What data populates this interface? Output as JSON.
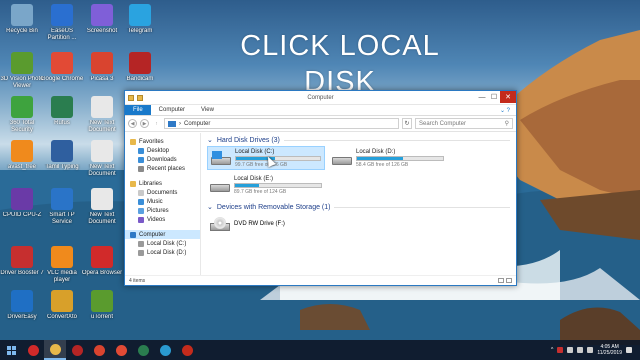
{
  "overlay": {
    "line1": "CLICK LOCAL",
    "line2": "DISK"
  },
  "desktop_icons": [
    {
      "label": "Recycle Bin",
      "icon": "recycle-bin-icon",
      "color": "#7aa6c9"
    },
    {
      "label": "EaseUS Partition ...",
      "icon": "easeus-icon",
      "color": "#2a6fd0"
    },
    {
      "label": "Screenshot",
      "icon": "screenshot-icon",
      "color": "#7f5fd8"
    },
    {
      "label": "Telegram",
      "icon": "telegram-icon",
      "color": "#2aa3e0"
    },
    {
      "label": "3D Vision Photo Viewer",
      "icon": "3d-vision-icon",
      "color": "#5a9b2e"
    },
    {
      "label": "Google Chrome",
      "icon": "chrome-icon",
      "color": "#e24a35"
    },
    {
      "label": "Picasa 3",
      "icon": "picasa-icon",
      "color": "#d9442f"
    },
    {
      "label": "Bandicam",
      "icon": "bandicam-icon",
      "color": "#b52525"
    },
    {
      "label": "360 Total Security",
      "icon": "360-icon",
      "color": "#3ea33e"
    },
    {
      "label": "Rufus",
      "icon": "rufus-icon",
      "color": "#2a7d4f"
    },
    {
      "label": "New Text Document",
      "icon": "text-doc-icon",
      "color": "#e8e8e8"
    },
    {
      "label": "avast_free",
      "icon": "avast-icon",
      "color": "#f08a1c"
    },
    {
      "label": "Tamil Typing",
      "icon": "typing-icon",
      "color": "#2f5f9f"
    },
    {
      "label": "New Text Document",
      "icon": "text-doc-icon",
      "color": "#e8e8e8"
    },
    {
      "label": "CPUID CPU-Z",
      "icon": "cpuz-icon",
      "color": "#6a3aa7"
    },
    {
      "label": "Smart TP Service",
      "icon": "smart-tp-icon",
      "color": "#2a74c8"
    },
    {
      "label": "New Text Document",
      "icon": "text-doc-icon",
      "color": "#e8e8e8"
    },
    {
      "label": "Driver Booster 7",
      "icon": "driver-booster-icon",
      "color": "#c62f2f"
    },
    {
      "label": "VLC media player",
      "icon": "vlc-icon",
      "color": "#f08a1c"
    },
    {
      "label": "Opera Browser",
      "icon": "opera-icon",
      "color": "#d12a2a"
    },
    {
      "label": "DriverEasy",
      "icon": "drivereasy-icon",
      "color": "#1f6fc4"
    },
    {
      "label": "ConvertXto",
      "icon": "convertxto-icon",
      "color": "#d8a02a"
    },
    {
      "label": "uTorrent",
      "icon": "utorrent-icon",
      "color": "#5a9b2e"
    }
  ],
  "window": {
    "title": "Computer",
    "ribbon_tabs": [
      "File",
      "Computer",
      "View"
    ],
    "address": "Computer",
    "search_placeholder": "Search Computer",
    "nav": {
      "favorites": "Favorites",
      "fav_items": [
        "Desktop",
        "Downloads",
        "Recent places"
      ],
      "libraries": "Libraries",
      "lib_items": [
        "Documents",
        "Music",
        "Pictures",
        "Videos"
      ],
      "computer": "Computer",
      "comp_items": [
        "Local Disk (C:)",
        "Local Disk (D:)"
      ]
    },
    "hdd_group": "Hard Disk Drives (3)",
    "drives": [
      {
        "name": "Local Disk (C:)",
        "free": "99.7 GB free of 186 GB",
        "used_fraction": 0.46,
        "selected": true,
        "windows": true
      },
      {
        "name": "Local Disk (D:)",
        "free": "58.4 GB free of 126 GB",
        "used_fraction": 0.54,
        "selected": false,
        "windows": false
      },
      {
        "name": "Local Disk (E:)",
        "free": "89.7 GB free of 124 GB",
        "used_fraction": 0.28,
        "selected": false,
        "windows": false
      }
    ],
    "removable_group": "Devices with Removable Storage (1)",
    "dvd": "DVD RW Drive (F:)",
    "status": "4 items"
  },
  "taskbar": {
    "apps": [
      {
        "icon": "opera-taskbar-icon",
        "color": "#d12a2a"
      },
      {
        "icon": "file-explorer-taskbar-icon",
        "color": "#e8b84a"
      },
      {
        "icon": "bandicam-taskbar-icon",
        "color": "#b52525"
      },
      {
        "icon": "davinci-taskbar-icon",
        "color": "#d9442f"
      },
      {
        "icon": "chrome-taskbar-icon",
        "color": "#e24a35"
      },
      {
        "icon": "rufus-taskbar-icon",
        "color": "#2a7d4f"
      },
      {
        "icon": "app-taskbar-icon",
        "color": "#2a9ad0"
      },
      {
        "icon": "record-taskbar-icon",
        "color": "#c42b1c"
      }
    ],
    "time": "4:05 AM",
    "date": "11/25/2019"
  }
}
